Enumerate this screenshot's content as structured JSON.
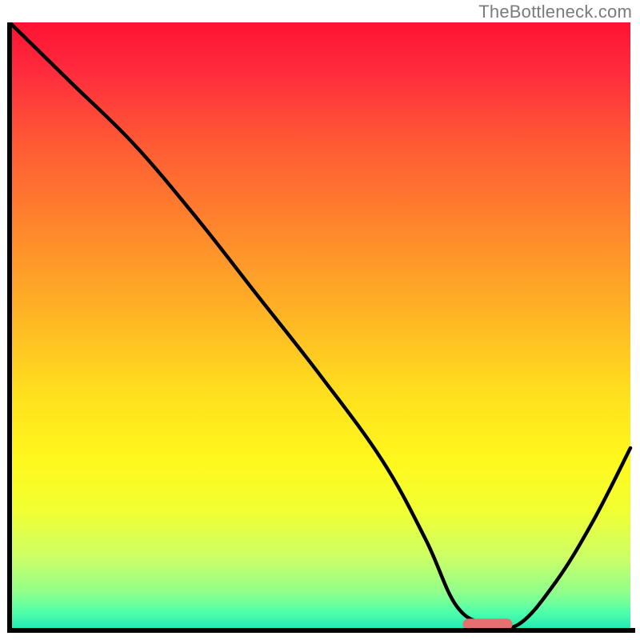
{
  "watermark": "TheBottleneck.com",
  "chart_data": {
    "type": "line",
    "title": "",
    "xlabel": "",
    "ylabel": "",
    "xlim": [
      0,
      100
    ],
    "ylim": [
      0,
      100
    ],
    "grid": false,
    "legend": null,
    "annotations": [],
    "gradient_stops": [
      {
        "offset": 0.0,
        "color": "#ff1233"
      },
      {
        "offset": 0.08,
        "color": "#ff2b3e"
      },
      {
        "offset": 0.2,
        "color": "#ff5a34"
      },
      {
        "offset": 0.35,
        "color": "#ff8a2c"
      },
      {
        "offset": 0.5,
        "color": "#ffbb24"
      },
      {
        "offset": 0.62,
        "color": "#ffe21e"
      },
      {
        "offset": 0.72,
        "color": "#fff81d"
      },
      {
        "offset": 0.8,
        "color": "#f2ff31"
      },
      {
        "offset": 0.88,
        "color": "#ccff66"
      },
      {
        "offset": 0.94,
        "color": "#8dff8d"
      },
      {
        "offset": 0.97,
        "color": "#4fffaa"
      },
      {
        "offset": 1.0,
        "color": "#1de9b6"
      }
    ],
    "series": [
      {
        "name": "bottleneck-curve",
        "x": [
          0,
          10,
          20,
          30,
          40,
          50,
          60,
          67,
          72,
          77,
          82,
          88,
          94,
          100
        ],
        "y": [
          100,
          90,
          80,
          68,
          55,
          42,
          28,
          15,
          4,
          1,
          1,
          8,
          18,
          30
        ]
      }
    ],
    "marker": {
      "name": "optimal-range",
      "x_start": 73,
      "x_end": 81,
      "y": 1,
      "color": "#e4716f"
    }
  }
}
